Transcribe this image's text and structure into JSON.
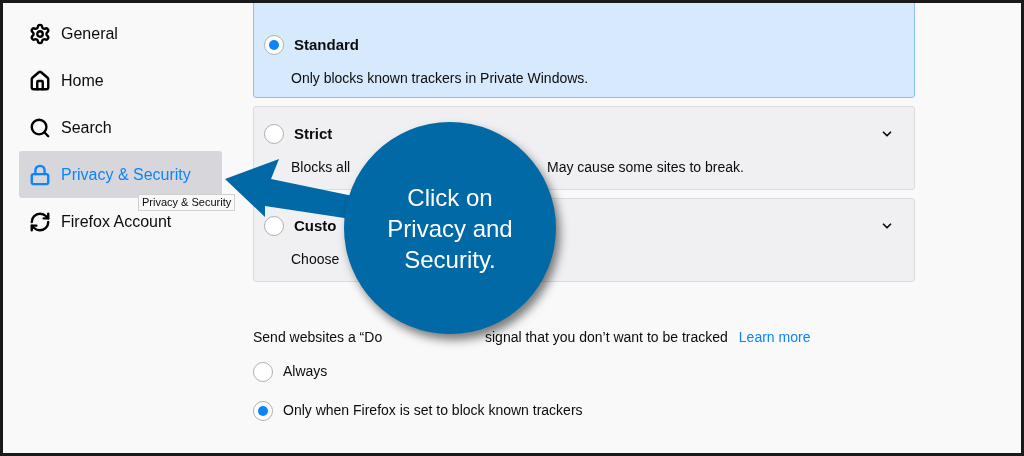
{
  "sidebar": {
    "items": [
      {
        "label": "General",
        "selected": false
      },
      {
        "label": "Home",
        "selected": false
      },
      {
        "label": "Search",
        "selected": false
      },
      {
        "label": "Privacy & Security",
        "selected": true
      },
      {
        "label": "Firefox Account",
        "selected": false
      }
    ],
    "tooltip": "Privacy & Security"
  },
  "protection_options": [
    {
      "title": "Standard",
      "description_parts": [
        "Only blocks known trackers in Private Windows."
      ],
      "selected": true
    },
    {
      "title": "Strict",
      "description_parts": [
        "Blocks all",
        "May cause some sites to break."
      ],
      "selected": false
    },
    {
      "title": "Custo",
      "description_parts": [
        "Choose"
      ],
      "selected": false
    }
  ],
  "do_not_track": {
    "text_parts": [
      "Send websites a “Do",
      "signal that you don’t want to be tracked"
    ],
    "link": "Learn more",
    "options": [
      {
        "label": "Always",
        "selected": false
      },
      {
        "label": "Only when Firefox is set to block known trackers",
        "selected": true
      }
    ]
  },
  "callout": {
    "text": "Click on Privacy and Security."
  }
}
